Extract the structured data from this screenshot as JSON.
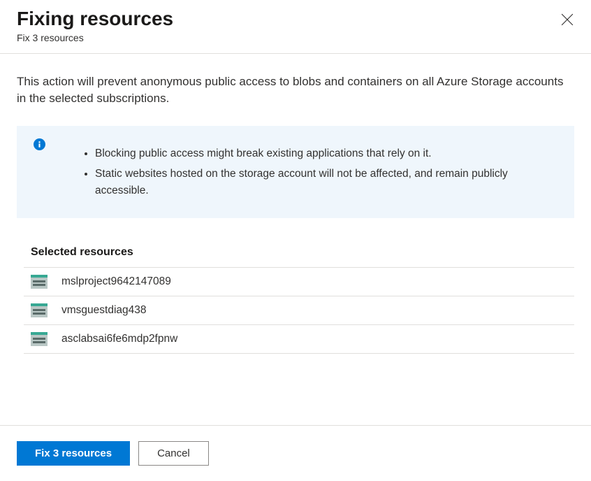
{
  "header": {
    "title": "Fixing resources",
    "subtitle": "Fix 3 resources"
  },
  "content": {
    "description": "This action will prevent anonymous public access to blobs and containers on all Azure Storage accounts in the selected subscriptions.",
    "info_items": [
      "Blocking public access might break existing applications that rely on it.",
      "Static websites hosted on the storage account will not be affected, and remain publicly accessible."
    ],
    "section_title": "Selected resources",
    "resources": [
      {
        "name": "mslproject9642147089"
      },
      {
        "name": "vmsguestdiag438"
      },
      {
        "name": "asclabsai6fe6mdp2fpnw"
      }
    ]
  },
  "footer": {
    "primary_label": "Fix 3 resources",
    "secondary_label": "Cancel"
  }
}
